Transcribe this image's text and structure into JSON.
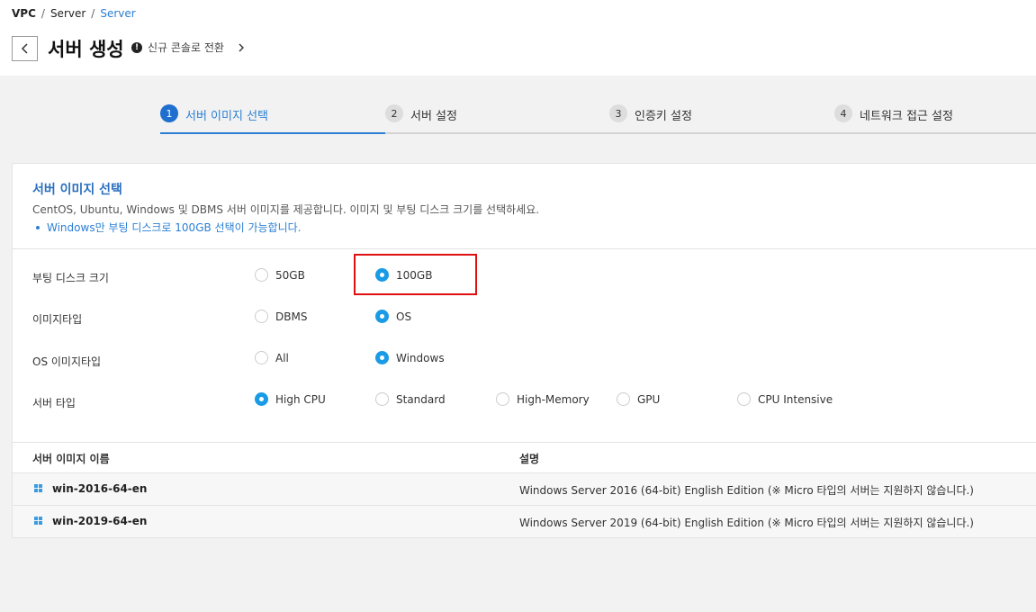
{
  "breadcrumb": {
    "root": "VPC",
    "mid": "Server",
    "current": "Server",
    "separator": "/"
  },
  "header": {
    "title": "서버 생성",
    "switch_label": "신규 콘솔로 전환",
    "alert_glyph": "!"
  },
  "steps": [
    {
      "num": "1",
      "label": "서버 이미지 선택",
      "active": true
    },
    {
      "num": "2",
      "label": "서버 설정",
      "active": false
    },
    {
      "num": "3",
      "label": "인증키 설정",
      "active": false
    },
    {
      "num": "4",
      "label": "네트워크 접근 설정",
      "active": false
    }
  ],
  "section": {
    "title": "서버 이미지 선택",
    "description": "CentOS, Ubuntu, Windows 및 DBMS 서버 이미지를 제공합니다. 이미지 및 부팅 디스크 크기를 선택하세요.",
    "note": "Windows만 부팅 디스크로 100GB 선택이 가능합니다."
  },
  "options": {
    "boot_disk": {
      "label": "부팅 디스크 크기",
      "choices": [
        "50GB",
        "100GB"
      ],
      "selected": "100GB"
    },
    "image_type": {
      "label": "이미지타입",
      "choices": [
        "DBMS",
        "OS"
      ],
      "selected": "OS"
    },
    "os_image_type": {
      "label": "OS 이미지타입",
      "choices": [
        "All",
        "Windows"
      ],
      "selected": "Windows"
    },
    "server_type": {
      "label": "서버 타입",
      "choices": [
        "High CPU",
        "Standard",
        "High-Memory",
        "GPU",
        "CPU Intensive"
      ],
      "selected": "High CPU"
    }
  },
  "table": {
    "headers": {
      "name": "서버 이미지 이름",
      "desc": "설명"
    },
    "rows": [
      {
        "name": "win-2016-64-en",
        "desc": "Windows Server 2016 (64-bit) English Edition (※ Micro 타입의 서버는 지원하지 않습니다.)"
      },
      {
        "name": "win-2019-64-en",
        "desc": "Windows Server 2019 (64-bit) English Edition (※ Micro 타입의 서버는 지원하지 않습니다.)"
      }
    ]
  },
  "colors": {
    "accent": "#2a7fd4",
    "radio_on": "#1a9be6",
    "highlight": "#e01010"
  }
}
